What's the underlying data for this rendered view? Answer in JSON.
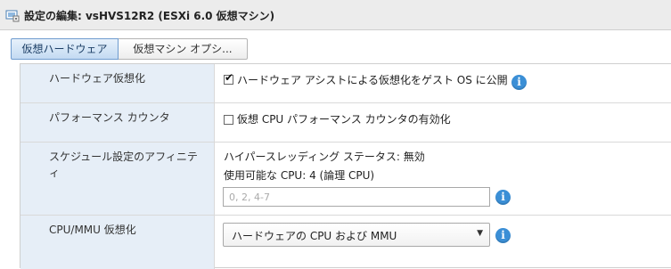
{
  "window": {
    "title": "設定の編集: vsHVS12R2 (ESXi 6.0 仮想マシン)",
    "icon": "vm-settings-icon"
  },
  "tabs": [
    {
      "label": "仮想ハードウェア",
      "active": true
    },
    {
      "label": "仮想マシン オプシ...",
      "active": false
    }
  ],
  "settings": {
    "hw_virtualization": {
      "label": "ハードウェア仮想化",
      "checkbox_label": "ハードウェア アシストによる仮想化をゲスト OS に公開",
      "checked": true
    },
    "perf_counter": {
      "label": "パフォーマンス カウンタ",
      "checkbox_label": "仮想 CPU パフォーマンス カウンタの有効化",
      "checked": false
    },
    "affinity": {
      "label": "スケジュール設定のアフィニティ",
      "hyperthreading_status": "ハイパースレッディング ステータス: 無効",
      "available_cpu": "使用可能な CPU: 4 (論理 CPU)",
      "input_placeholder": "0, 2, 4-7",
      "input_value": ""
    },
    "cpu_mmu": {
      "label": "CPU/MMU 仮想化",
      "selected": "ハードウェアの CPU および MMU"
    }
  },
  "icons": {
    "info": "i",
    "check": "✔",
    "dropdown": "▼"
  },
  "colors": {
    "label_bg": "#e6eef7",
    "info_blue": "#3b8fd6",
    "active_tab": "#c3daf2"
  }
}
